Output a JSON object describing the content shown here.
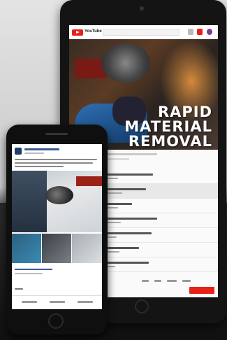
{
  "scene": {
    "description_tag": "tablet and phone showing video and social post"
  },
  "tablet": {
    "app": "YouTube",
    "wordmark": "YouTube",
    "video_title_lines": [
      "RAPID",
      "MATERIAL",
      "REMOVAL"
    ]
  },
  "phone": {
    "app": "Facebook post"
  },
  "colors": {
    "youtube_red": "#e62117",
    "facebook_blue": "#3b5998",
    "sleeve_blue": "#2f6fb2"
  }
}
